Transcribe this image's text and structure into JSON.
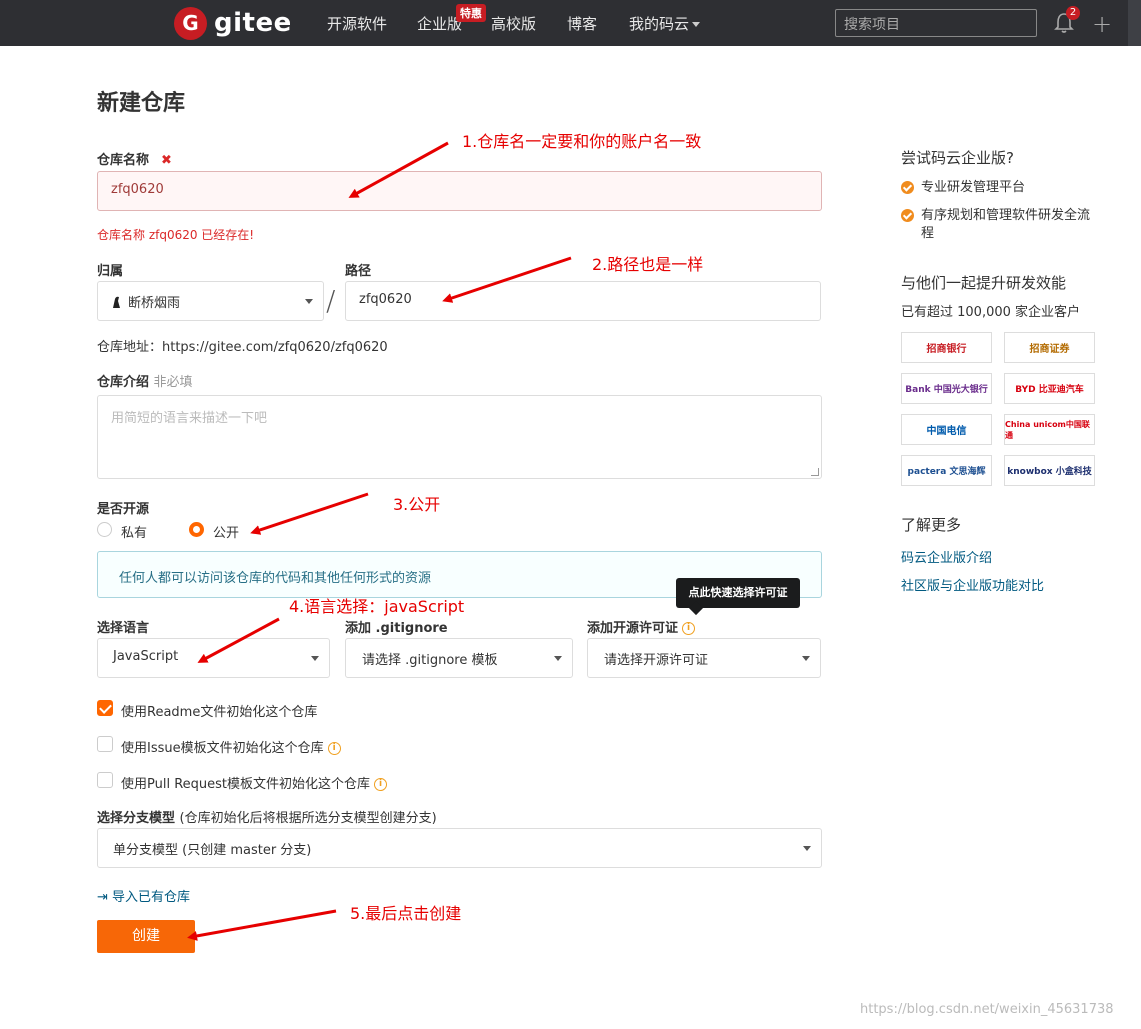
{
  "nav": {
    "logo_letter": "G",
    "logo_text": "gitee",
    "items": [
      "开源软件",
      "企业版",
      "高校版",
      "博客",
      "我的码云"
    ],
    "badge": "特惠",
    "search_placeholder": "搜索项目",
    "notif_count": "2"
  },
  "page": {
    "title": "新建仓库",
    "repo_name_label": "仓库名称",
    "repo_name_value": "zfq0620",
    "repo_name_error": "仓库名称 zfq0620 已经存在!",
    "owner_label": "归属",
    "owner_value": "断桥烟雨",
    "path_label": "路径",
    "path_value": "zfq0620",
    "repo_url": "仓库地址：https://gitee.com/zfq0620/zfq0620",
    "desc_label": "仓库介绍",
    "desc_optional": "非必填",
    "desc_placeholder": "用简短的语言来描述一下吧",
    "open_label": "是否开源",
    "private_label": "私有",
    "public_label": "公开",
    "public_info": "任何人都可以访问该仓库的代码和其他任何形式的资源",
    "license_tooltip": "点此快速选择许可证",
    "lang_label": "选择语言",
    "lang_value": "JavaScript",
    "gitignore_label": "添加 .gitignore",
    "gitignore_value": "请选择 .gitignore 模板",
    "license_label": "添加开源许可证",
    "license_value": "请选择开源许可证",
    "cb_readme": "使用Readme文件初始化这个仓库",
    "cb_issue": "使用Issue模板文件初始化这个仓库",
    "cb_pr": "使用Pull Request模板文件初始化这个仓库",
    "branch_label": "选择分支模型",
    "branch_hint": "(仓库初始化后将根据所选分支模型创建分支)",
    "branch_value": "单分支模型 (只创建 master 分支)",
    "import_label": "导入已有仓库",
    "create_label": "创建"
  },
  "sidebar": {
    "try_title": "尝试码云企业版?",
    "feature1": "专业研发管理平台",
    "feature2": "有序规划和管理软件研发全流程",
    "together_title": "与他们一起提升研发效能",
    "customers": "已有超过 100,000 家企业客户",
    "logos": [
      "招商银行",
      "招商证券",
      "Bank 中国光大银行",
      "BYD 比亚迪汽车",
      "中国电信",
      "China unicom中国联通",
      "pactera 文思海辉",
      "knowbox 小盒科技"
    ],
    "learn_title": "了解更多",
    "link1": "码云企业版介绍",
    "link2": "社区版与企业版功能对比"
  },
  "annotations": {
    "a1": "1.仓库名一定要和你的账户名一致",
    "a2": "2.路径也是一样",
    "a3": "3.公开",
    "a4": "4.语言选择：javaScript",
    "a5": "5.最后点击创建"
  },
  "watermark": "https://blog.csdn.net/weixin_45631738",
  "colors": {
    "accent": "#f76707",
    "nav_bg": "#2e2f33",
    "annotation": "#e60000",
    "error": "#db2828"
  }
}
